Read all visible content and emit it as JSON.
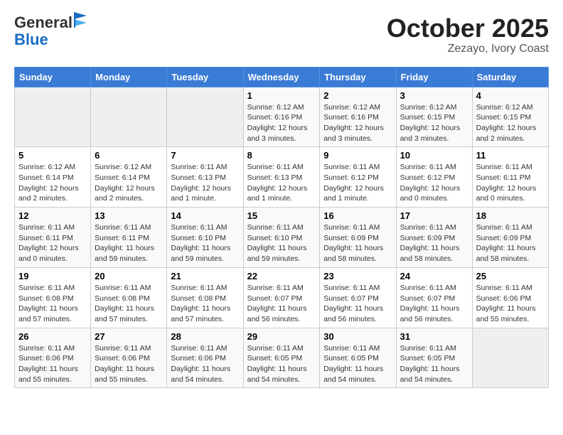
{
  "header": {
    "logo_general": "General",
    "logo_blue": "Blue",
    "month_title": "October 2025",
    "subtitle": "Zezayo, Ivory Coast"
  },
  "weekdays": [
    "Sunday",
    "Monday",
    "Tuesday",
    "Wednesday",
    "Thursday",
    "Friday",
    "Saturday"
  ],
  "weeks": [
    [
      {
        "day": "",
        "info": ""
      },
      {
        "day": "",
        "info": ""
      },
      {
        "day": "",
        "info": ""
      },
      {
        "day": "1",
        "info": "Sunrise: 6:12 AM\nSunset: 6:16 PM\nDaylight: 12 hours\nand 3 minutes."
      },
      {
        "day": "2",
        "info": "Sunrise: 6:12 AM\nSunset: 6:16 PM\nDaylight: 12 hours\nand 3 minutes."
      },
      {
        "day": "3",
        "info": "Sunrise: 6:12 AM\nSunset: 6:15 PM\nDaylight: 12 hours\nand 3 minutes."
      },
      {
        "day": "4",
        "info": "Sunrise: 6:12 AM\nSunset: 6:15 PM\nDaylight: 12 hours\nand 2 minutes."
      }
    ],
    [
      {
        "day": "5",
        "info": "Sunrise: 6:12 AM\nSunset: 6:14 PM\nDaylight: 12 hours\nand 2 minutes."
      },
      {
        "day": "6",
        "info": "Sunrise: 6:12 AM\nSunset: 6:14 PM\nDaylight: 12 hours\nand 2 minutes."
      },
      {
        "day": "7",
        "info": "Sunrise: 6:11 AM\nSunset: 6:13 PM\nDaylight: 12 hours\nand 1 minute."
      },
      {
        "day": "8",
        "info": "Sunrise: 6:11 AM\nSunset: 6:13 PM\nDaylight: 12 hours\nand 1 minute."
      },
      {
        "day": "9",
        "info": "Sunrise: 6:11 AM\nSunset: 6:12 PM\nDaylight: 12 hours\nand 1 minute."
      },
      {
        "day": "10",
        "info": "Sunrise: 6:11 AM\nSunset: 6:12 PM\nDaylight: 12 hours\nand 0 minutes."
      },
      {
        "day": "11",
        "info": "Sunrise: 6:11 AM\nSunset: 6:11 PM\nDaylight: 12 hours\nand 0 minutes."
      }
    ],
    [
      {
        "day": "12",
        "info": "Sunrise: 6:11 AM\nSunset: 6:11 PM\nDaylight: 12 hours\nand 0 minutes."
      },
      {
        "day": "13",
        "info": "Sunrise: 6:11 AM\nSunset: 6:11 PM\nDaylight: 11 hours\nand 59 minutes."
      },
      {
        "day": "14",
        "info": "Sunrise: 6:11 AM\nSunset: 6:10 PM\nDaylight: 11 hours\nand 59 minutes."
      },
      {
        "day": "15",
        "info": "Sunrise: 6:11 AM\nSunset: 6:10 PM\nDaylight: 11 hours\nand 59 minutes."
      },
      {
        "day": "16",
        "info": "Sunrise: 6:11 AM\nSunset: 6:09 PM\nDaylight: 11 hours\nand 58 minutes."
      },
      {
        "day": "17",
        "info": "Sunrise: 6:11 AM\nSunset: 6:09 PM\nDaylight: 11 hours\nand 58 minutes."
      },
      {
        "day": "18",
        "info": "Sunrise: 6:11 AM\nSunset: 6:09 PM\nDaylight: 11 hours\nand 58 minutes."
      }
    ],
    [
      {
        "day": "19",
        "info": "Sunrise: 6:11 AM\nSunset: 6:08 PM\nDaylight: 11 hours\nand 57 minutes."
      },
      {
        "day": "20",
        "info": "Sunrise: 6:11 AM\nSunset: 6:08 PM\nDaylight: 11 hours\nand 57 minutes."
      },
      {
        "day": "21",
        "info": "Sunrise: 6:11 AM\nSunset: 6:08 PM\nDaylight: 11 hours\nand 57 minutes."
      },
      {
        "day": "22",
        "info": "Sunrise: 6:11 AM\nSunset: 6:07 PM\nDaylight: 11 hours\nand 56 minutes."
      },
      {
        "day": "23",
        "info": "Sunrise: 6:11 AM\nSunset: 6:07 PM\nDaylight: 11 hours\nand 56 minutes."
      },
      {
        "day": "24",
        "info": "Sunrise: 6:11 AM\nSunset: 6:07 PM\nDaylight: 11 hours\nand 56 minutes."
      },
      {
        "day": "25",
        "info": "Sunrise: 6:11 AM\nSunset: 6:06 PM\nDaylight: 11 hours\nand 55 minutes."
      }
    ],
    [
      {
        "day": "26",
        "info": "Sunrise: 6:11 AM\nSunset: 6:06 PM\nDaylight: 11 hours\nand 55 minutes."
      },
      {
        "day": "27",
        "info": "Sunrise: 6:11 AM\nSunset: 6:06 PM\nDaylight: 11 hours\nand 55 minutes."
      },
      {
        "day": "28",
        "info": "Sunrise: 6:11 AM\nSunset: 6:06 PM\nDaylight: 11 hours\nand 54 minutes."
      },
      {
        "day": "29",
        "info": "Sunrise: 6:11 AM\nSunset: 6:05 PM\nDaylight: 11 hours\nand 54 minutes."
      },
      {
        "day": "30",
        "info": "Sunrise: 6:11 AM\nSunset: 6:05 PM\nDaylight: 11 hours\nand 54 minutes."
      },
      {
        "day": "31",
        "info": "Sunrise: 6:11 AM\nSunset: 6:05 PM\nDaylight: 11 hours\nand 54 minutes."
      },
      {
        "day": "",
        "info": ""
      }
    ]
  ]
}
